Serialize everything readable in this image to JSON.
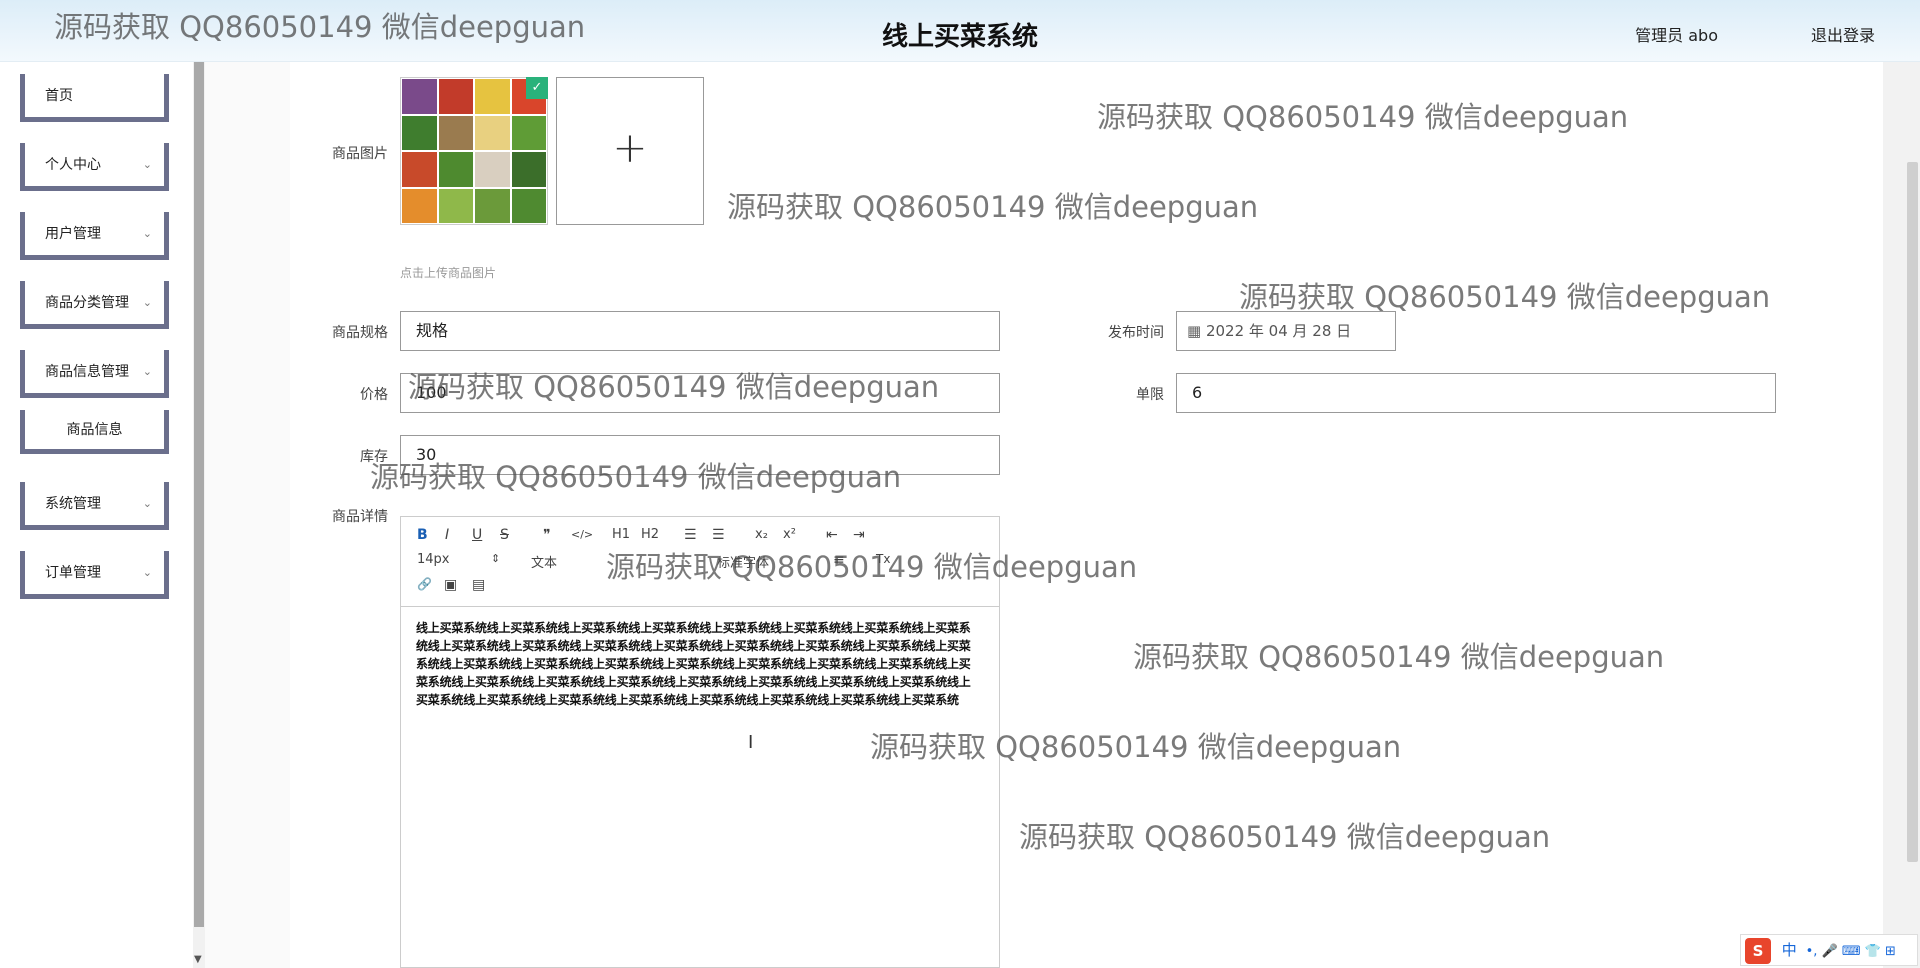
{
  "header": {
    "title": "线上买菜系统",
    "user": "管理员 abo",
    "logout": "退出登录"
  },
  "sidebar": {
    "items": [
      {
        "label": "首页"
      },
      {
        "label": "个人中心",
        "chevron": "⌄"
      },
      {
        "label": "用户管理",
        "chevron": "⌄"
      },
      {
        "label": "商品分类管理",
        "chevron": "⌄"
      },
      {
        "label": "商品信息管理",
        "chevron": "⌄"
      },
      {
        "label": "商品信息"
      },
      {
        "label": "系统管理",
        "chevron": "⌄"
      },
      {
        "label": "订单管理",
        "chevron": "⌄"
      }
    ]
  },
  "form": {
    "image_label": "商品图片",
    "upload_plus": "+",
    "image_check": "✓",
    "upload_hint": "点击上传商品图片",
    "spec_label": "商品规格",
    "spec_value": "规格",
    "publish_label": "发布时间",
    "publish_value": "2022 年 04 月 28 日",
    "price_label": "价格",
    "price_value": "100",
    "limit_label": "单限",
    "limit_value": "6",
    "stock_label": "库存",
    "stock_value": "30",
    "detail_label": "商品详情"
  },
  "editor": {
    "toolbar": {
      "bold": "B",
      "italic": "I",
      "underline": "U",
      "strike": "S",
      "quote": "❞",
      "code": "</>",
      "h1": "H1",
      "h2": "H2",
      "ol": "☰",
      "ul": "☰",
      "sub": "x₂",
      "sup": "x²",
      "outdent": "⇤",
      "indent": "⇥",
      "size": "14px",
      "size_arrow": "⇕",
      "text_type": "文本",
      "font": "标准字体",
      "align": "≡",
      "clear": "Tx",
      "link": "🔗",
      "image": "▣",
      "video": "▤"
    },
    "content": "线上买菜系统线上买菜系统线上买菜系统线上买菜系统线上买菜系统线上买菜系统线上买菜系统线上买菜系统线上买菜系统线上买菜系统线上买菜系统线上买菜系统线上买菜系统线上买菜系统线上买菜系统线上买菜系统线上买菜系统线上买菜系统线上买菜系统线上买菜系统线上买菜系统线上买菜系统线上买菜系统线上买菜系统线上买菜系统线上买菜系统线上买菜系统线上买菜系统线上买菜系统线上买菜系统线上买菜系统线上买菜系统线上买菜系统线上买菜系统线上买菜系统线上买菜系统线上买菜系统线上买菜系统线上买菜系统",
    "cursor": "I"
  },
  "watermark": "源码获取 QQ86050149 微信deepguan",
  "ime": {
    "logo": "S",
    "mode": "中",
    "icons": "•, 🎤 ⌨ 👕 ⊞"
  },
  "colors": {
    "header_bg": "#dcedf8",
    "menu_border": "#6b6f8c",
    "check_green": "#2ab27b"
  }
}
